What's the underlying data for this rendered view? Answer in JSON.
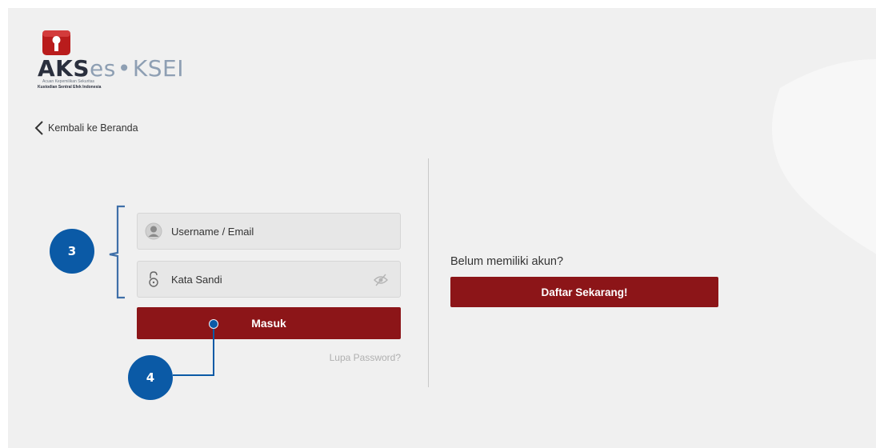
{
  "logo": {
    "brand_main": "AKS",
    "brand_es": "es",
    "brand_dot": "•",
    "brand_ksei": "KSEI",
    "tagline": "Acuan Kepemilikan Sekuritas",
    "company": "Kustodian Sentral Efek Indonesia"
  },
  "nav": {
    "back_label": "Kembali ke Beranda"
  },
  "login": {
    "username_placeholder": "Username / Email",
    "password_placeholder": "Kata Sandi",
    "submit_label": "Masuk",
    "forgot_label": "Lupa Password?"
  },
  "register": {
    "prompt": "Belum memiliki akun?",
    "button_label": "Daftar Sekarang!"
  },
  "annotations": {
    "step_fields": "3",
    "step_submit": "4"
  },
  "colors": {
    "primary_red": "#8c1518",
    "annotation_blue": "#0b5aa6",
    "page_bg": "#f0f0f0"
  },
  "icons": {
    "logo_badge": "keyhole-shield-icon",
    "back": "chevron-left-icon",
    "username": "user-avatar-icon",
    "password": "padlock-icon",
    "toggle_password": "eye-slash-icon"
  }
}
